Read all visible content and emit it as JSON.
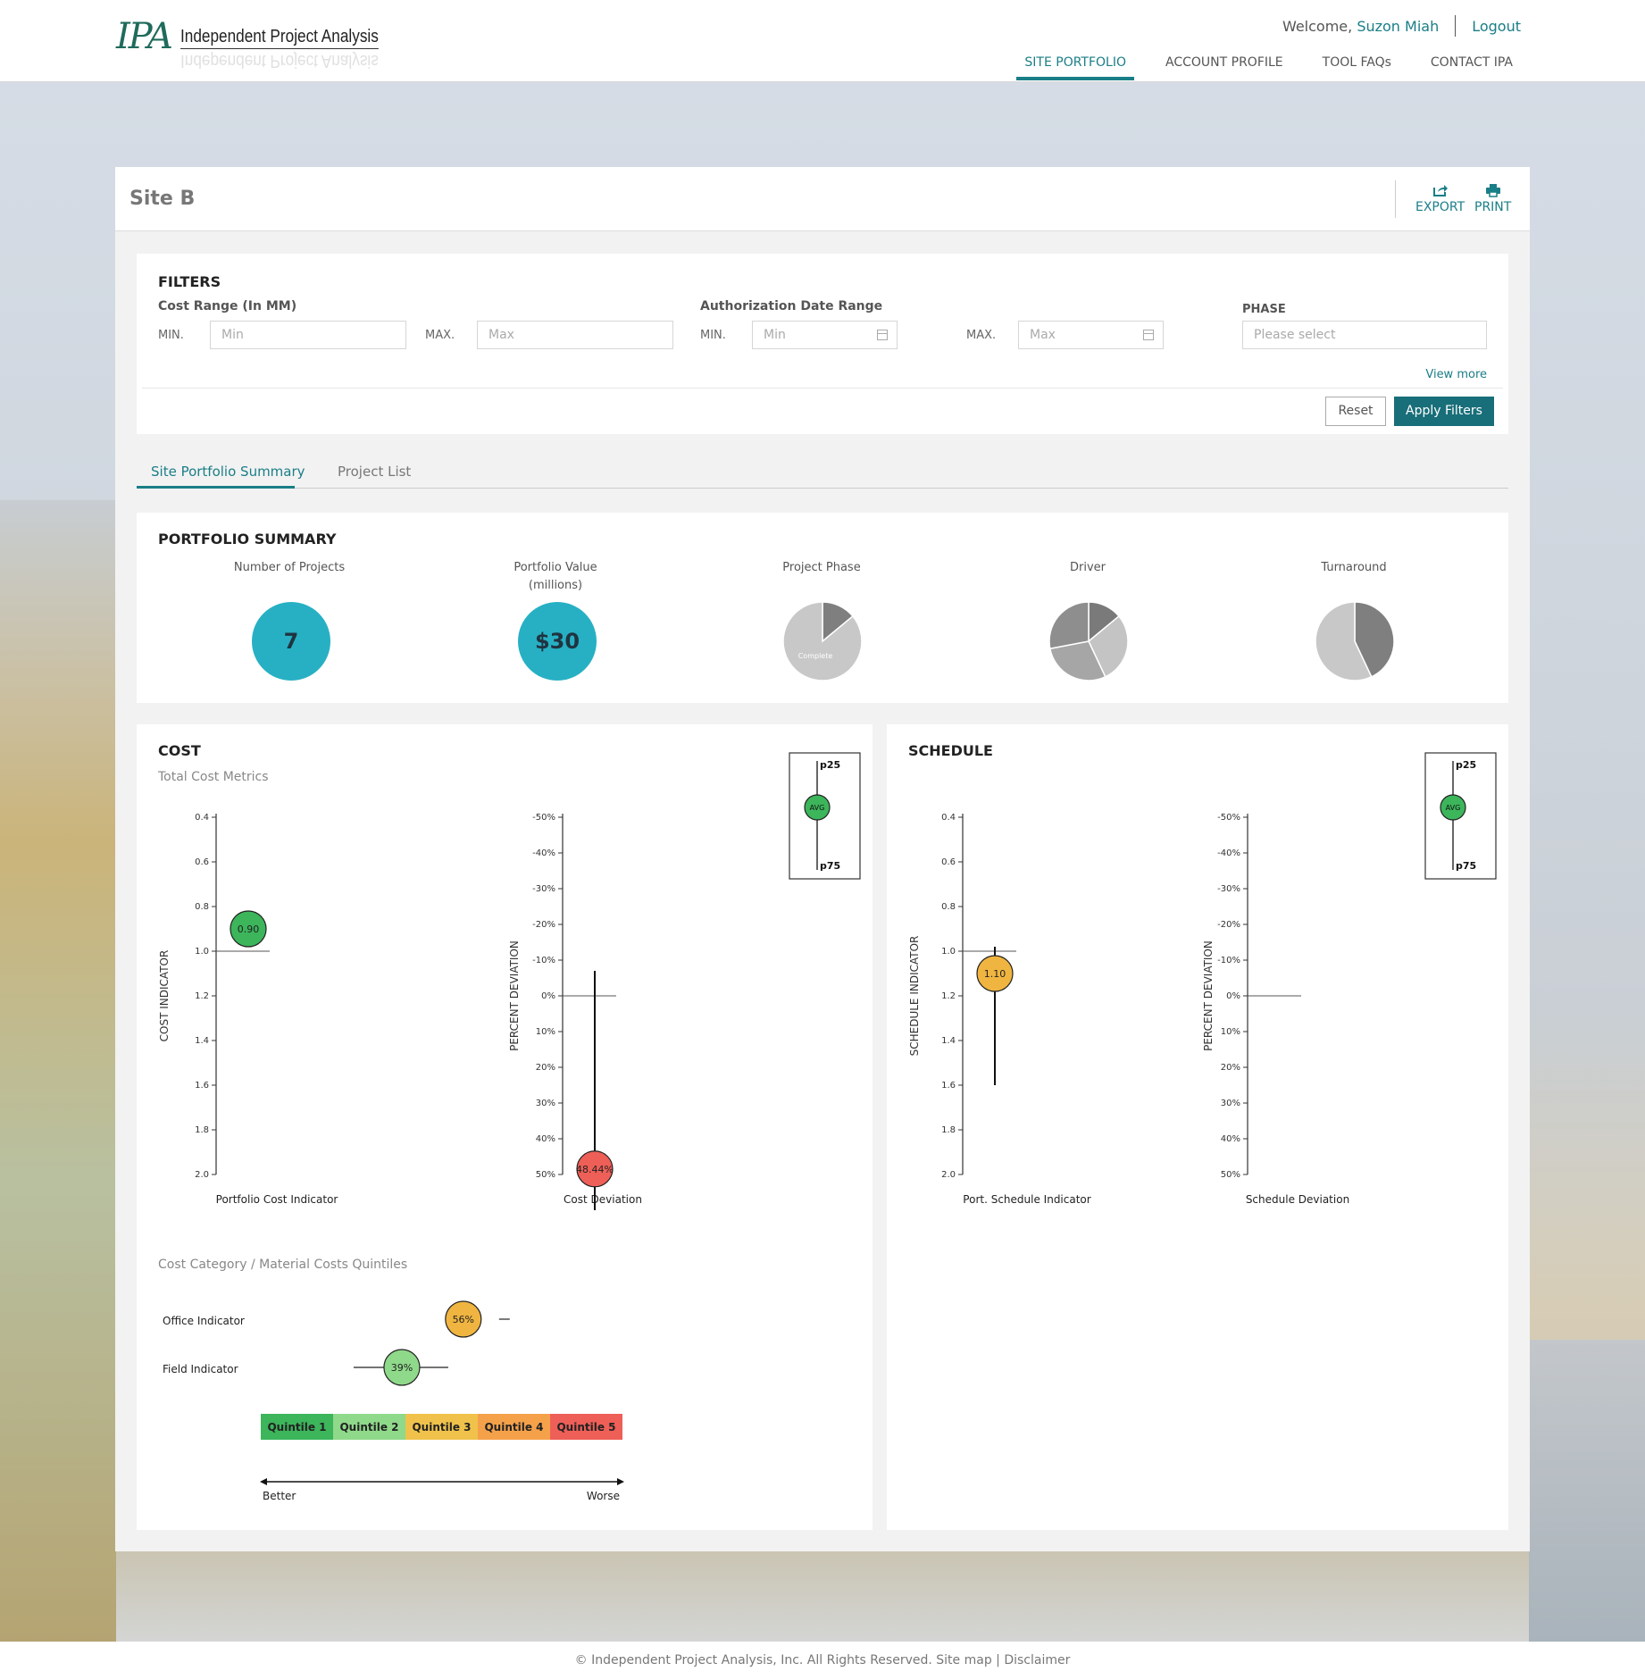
{
  "header": {
    "logo_mark": "IPA",
    "logo_text": "Independent Project Analysis",
    "welcome": "Welcome,",
    "user": "Suzon Miah",
    "logout": "Logout",
    "nav": [
      "SITE PORTFOLIO",
      "ACCOUNT PROFILE",
      "TOOL FAQs",
      "CONTACT IPA"
    ]
  },
  "page": {
    "title": "Site B",
    "export": "EXPORT",
    "print": "PRINT"
  },
  "filters": {
    "heading": "FILTERS",
    "cost_label": "Cost Range (In MM)",
    "date_label": "Authorization Date Range",
    "phase_label": "PHASE",
    "min": "MIN.",
    "max": "MAX.",
    "min_placeholder": "Min",
    "max_placeholder": "Max",
    "phase_placeholder": "Please select",
    "view_more": "View more",
    "reset": "Reset",
    "apply": "Apply Filters"
  },
  "tabs": [
    "Site Portfolio Summary",
    "Project List"
  ],
  "summary": {
    "heading": "PORTFOLIO SUMMARY",
    "num_projects_label": "Number of Projects",
    "num_projects": "7",
    "value_label": "Portfolio Value",
    "value_sub": "(millions)",
    "value": "$30",
    "phase_label": "Project Phase",
    "phase_slice_label": "Complete",
    "driver_label": "Driver",
    "turnaround_label": "Turnaround"
  },
  "cost": {
    "heading": "COST",
    "subtitle": "Total Cost Metrics",
    "legend": {
      "top": "p25",
      "mid": "AVG",
      "bottom": "p75"
    },
    "quintile_title": "Cost Category / Material Costs Quintiles",
    "office_label": "Office Indicator",
    "field_label": "Field Indicator",
    "quintiles": [
      "Quintile 1",
      "Quintile 2",
      "Quintile 3",
      "Quintile 4",
      "Quintile 5"
    ],
    "better": "Better",
    "worse": "Worse"
  },
  "schedule": {
    "heading": "SCHEDULE",
    "legend": {
      "top": "p25",
      "mid": "AVG",
      "bottom": "p75"
    }
  },
  "chart_data": [
    {
      "type": "scatter",
      "title": "",
      "xlabel": "Portfolio Cost Indicator",
      "ylabel": "COST INDICATOR",
      "ylim": [
        0.4,
        2.0
      ],
      "yticks": [
        "0.4",
        "0.6",
        "0.8",
        "1.0",
        "1.2",
        "1.4",
        "1.6",
        "1.8",
        "2.0"
      ],
      "reference": 1.0,
      "value": 0.9,
      "value_label": "0.90",
      "color": "#3cb55b"
    },
    {
      "type": "scatter",
      "title": "",
      "xlabel": "Cost Deviation",
      "ylabel": "PERCENT DEVIATION",
      "ylim": [
        -50,
        50
      ],
      "yticks": [
        "-50%",
        "-40%",
        "-30%",
        "-20%",
        "-10%",
        "0%",
        "10%",
        "20%",
        "30%",
        "40%",
        "50%"
      ],
      "reference": 0,
      "value": 48.44,
      "value_label": "48.44%",
      "range": [
        -7,
        60
      ],
      "color": "#ee5f57"
    },
    {
      "type": "scatter",
      "title": "",
      "xlabel": "Port. Schedule Indicator",
      "ylabel": "SCHEDULE INDICATOR",
      "ylim": [
        0.4,
        2.0
      ],
      "yticks": [
        "0.4",
        "0.6",
        "0.8",
        "1.0",
        "1.2",
        "1.4",
        "1.6",
        "1.8",
        "2.0"
      ],
      "reference": 1.0,
      "value": 1.1,
      "value_label": "1.10",
      "range": [
        0.98,
        1.6
      ],
      "color": "#f0b540"
    },
    {
      "type": "scatter",
      "title": "",
      "xlabel": "Schedule Deviation",
      "ylabel": "PERCENT DEVIATION",
      "ylim": [
        -50,
        50
      ],
      "yticks": [
        "-50%",
        "-40%",
        "-30%",
        "-20%",
        "-10%",
        "0%",
        "10%",
        "20%",
        "30%",
        "40%",
        "50%"
      ],
      "reference": 0
    },
    {
      "type": "pie",
      "title": "Project Phase",
      "values": [
        0.14,
        0.86
      ],
      "labels": [
        "",
        "Complete"
      ],
      "colors": [
        "#7f7f7f",
        "#c8c8c8"
      ]
    },
    {
      "type": "pie",
      "title": "Driver",
      "values": [
        0.14,
        0.29,
        0.29,
        0.28
      ],
      "colors": [
        "#7a7a7a",
        "#c4c4c4",
        "#a6a6a6",
        "#8e8e8e"
      ]
    },
    {
      "type": "pie",
      "title": "Turnaround",
      "values": [
        0.43,
        0.57
      ],
      "colors": [
        "#7f7f7f",
        "#c8c8c8"
      ]
    },
    {
      "type": "scatter",
      "title": "Cost Category / Material Costs Quintiles",
      "series": [
        {
          "name": "Office Indicator",
          "value": 56,
          "value_label": "56%",
          "color": "#f0b540"
        },
        {
          "name": "Field Indicator",
          "value": 39,
          "value_label": "39%",
          "color": "#8fd98a"
        }
      ],
      "quintile_colors": [
        "#3cb55b",
        "#8fd98a",
        "#f0c24b",
        "#f5a14a",
        "#ee5f57"
      ]
    }
  ]
}
